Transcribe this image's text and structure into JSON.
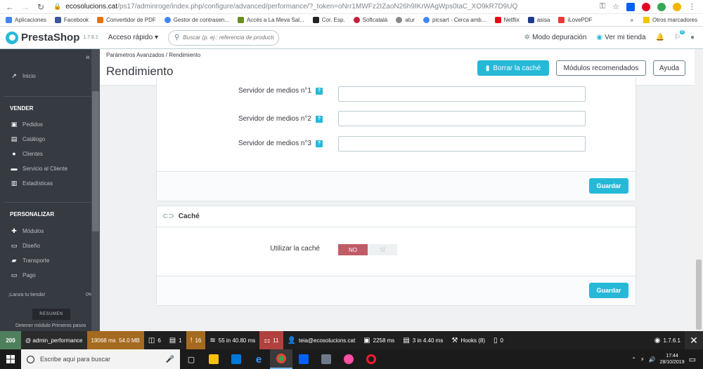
{
  "browser": {
    "url_domain": "ecosolucions.cat",
    "url_path": "/ps17/adminroge/index.php/configure/advanced/performance/?_token=oNrr1MWFz2IZaoN26h9IKrWAgWps0taC_XO9kR7D9UQ",
    "bookmarks": [
      "Aplicaciones",
      "Facebook",
      "Convertidor de PDF",
      "Gestor de contrasen...",
      "Accés a La Meva Sal...",
      "Cor. Esp.",
      "Softcatalà",
      "atur",
      "picsart - Cerca amb...",
      "Netflix",
      "asisa",
      "iLovePDF"
    ],
    "bookmark_colors": [
      "#4285f4",
      "#3b5998",
      "#e8710a",
      "#4285f4",
      "#6b8e23",
      "#222222",
      "#c41e3a",
      "#888888",
      "#4285f4",
      "#e50914",
      "#1e3a8a",
      "#e53935"
    ],
    "other_bookmarks": "Otros marcadores",
    "more_bookmarks": "»"
  },
  "header": {
    "logo": "PrestaShop",
    "version": "1.7.6.1",
    "quick_access": "Acceso rápido",
    "search_placeholder": "Buscar (p. ej.: referencia de producto, nombre de cliente...)",
    "debug_mode": "Modo depuración",
    "view_shop": "Ver mi tienda",
    "cart_badge": "9"
  },
  "sidebar": {
    "home": "Inicio",
    "section_sell": "VENDER",
    "sell_items": [
      "Pedidos",
      "Catálogo",
      "Clientes",
      "Servicio al Cliente",
      "Estadísticas"
    ],
    "section_customize": "PERSONALIZAR",
    "customize_items": [
      "Módulos",
      "Diseño",
      "Transporte",
      "Pago"
    ],
    "launch_shop": "¡Lanza tu tienda!",
    "launch_percent": "0%",
    "resumen": "RESUMEN",
    "tip": "Detener módulo Primeros pasos"
  },
  "page": {
    "breadcrumb": "Parámetros Avanzados  /  Rendimiento",
    "title": "Rendimiento",
    "clear_cache": "Borrar la caché",
    "recommended_modules": "Módulos recomendados",
    "help": "Ayuda"
  },
  "media_servers": {
    "labels": [
      "Servidor de medios n°1",
      "Servidor de medios n°2",
      "Servidor de medios n°3"
    ],
    "help_mark": "?",
    "values": [
      "",
      "",
      ""
    ],
    "save": "Guardar"
  },
  "cache": {
    "title": "Caché",
    "use_cache_label": "Utilizar la caché",
    "no": "NO",
    "yes": "SÍ",
    "selected": "NO",
    "save": "Guardar"
  },
  "debugbar": {
    "status": "200",
    "route": "@ admin_performance",
    "time": "19068 ms",
    "memory": "54.0 MB",
    "config": "6",
    "files": "1",
    "warnings": "16",
    "db": "55 in 40.80 ms",
    "modules_count": "11",
    "employee": "teia@ecosolucions.cat",
    "size": "2258 ms",
    "hooks_time": "3 in 4.40 ms",
    "hooks": "Hooks (8)",
    "objects": "0",
    "ps_version": "1.7.6.1"
  },
  "taskbar": {
    "search_placeholder": "Escribe aquí para buscar",
    "time": "17:44",
    "date": "28/10/2019"
  }
}
